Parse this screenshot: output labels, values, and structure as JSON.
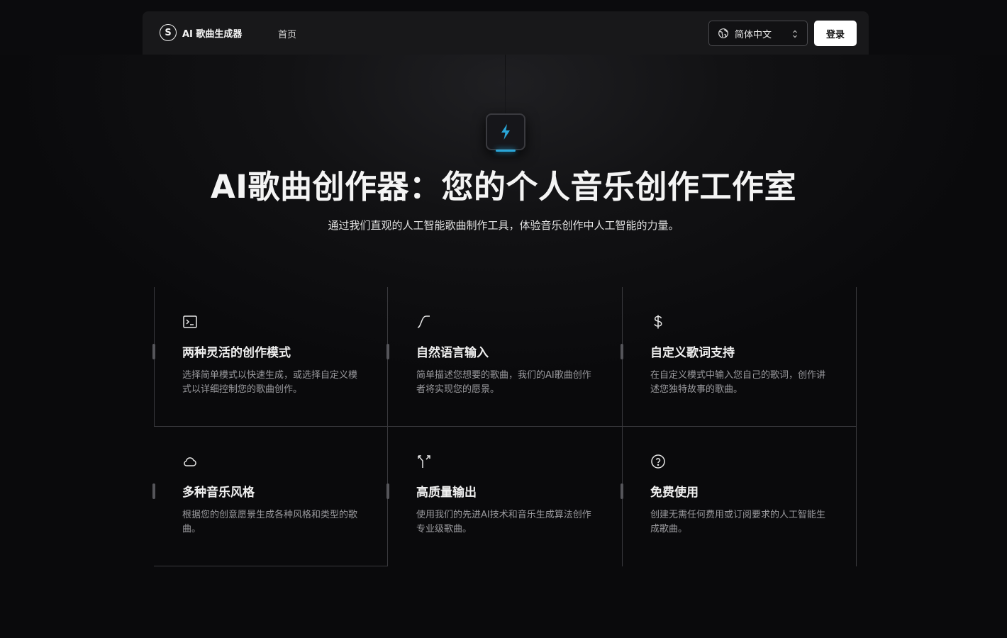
{
  "nav": {
    "brand_logo_letter": "S",
    "brand_name": "AI 歌曲生成器",
    "home_label": "首页",
    "language_value": "简体中文",
    "login_label": "登录"
  },
  "hero": {
    "title": "AI歌曲创作器：您的个人音乐创作工作室",
    "subtitle": "通过我们直观的人工智能歌曲制作工具，体验音乐创作中人工智能的力量。",
    "icon": "lightning-icon",
    "accent_color": "#2aa6d8"
  },
  "features": [
    {
      "icon": "terminal-icon",
      "title": "两种灵活的创作模式",
      "desc": "选择简单模式以快速生成，或选择自定义模式以详细控制您的歌曲创作。"
    },
    {
      "icon": "curve-icon",
      "title": "自然语言输入",
      "desc": "简单描述您想要的歌曲，我们的AI歌曲创作者将实现您的愿景。"
    },
    {
      "icon": "dollar-icon",
      "title": "自定义歌词支持",
      "desc": "在自定义模式中输入您自己的歌词，创作讲述您独特故事的歌曲。"
    },
    {
      "icon": "cloud-icon",
      "title": "多种音乐风格",
      "desc": "根据您的创意愿景生成各种风格和类型的歌曲。"
    },
    {
      "icon": "split-arrows-icon",
      "title": "高质量输出",
      "desc": "使用我们的先进AI技术和音乐生成算法创作专业级歌曲。"
    },
    {
      "icon": "help-circle-icon",
      "title": "免费使用",
      "desc": "创建无需任何费用或订阅要求的人工智能生成歌曲。"
    }
  ]
}
